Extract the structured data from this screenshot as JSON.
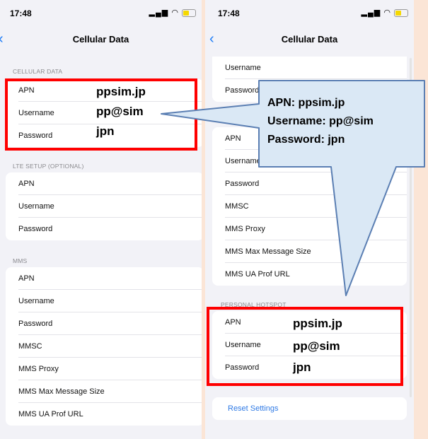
{
  "left": {
    "status": {
      "time": "17:48",
      "icons": "ᴵᴵᴵ ≋"
    },
    "nav": {
      "back": "‹",
      "title": "Cellular Data"
    },
    "sections": [
      {
        "header": "CELLULAR DATA",
        "rows": [
          "APN",
          "Username",
          "Password"
        ]
      },
      {
        "header": "LTE SETUP (OPTIONAL)",
        "rows": [
          "APN",
          "Username",
          "Password"
        ]
      },
      {
        "header": "MMS",
        "rows": [
          "APN",
          "Username",
          "Password",
          "MMSC",
          "MMS Proxy",
          "MMS Max Message Size",
          "MMS UA Prof URL"
        ]
      }
    ],
    "overlay": {
      "apn": "ppsim.jp",
      "username": "pp@sim",
      "password": "jpn"
    }
  },
  "right": {
    "status": {
      "time": "17:48",
      "icons": "ᴵᴵᴵ ≋"
    },
    "nav": {
      "back": "‹",
      "title": "Cellular Data"
    },
    "top_rows": [
      "Username",
      "Password"
    ],
    "lte_rows": [
      "APN",
      "Username",
      "Password",
      "MMSC",
      "MMS Proxy",
      "MMS Max Message Size",
      "MMS UA Prof URL"
    ],
    "hotspot": {
      "header": "PERSONAL HOTSPOT",
      "rows": [
        "APN",
        "Username",
        "Password"
      ]
    },
    "reset_label": "Reset Settings",
    "overlay": {
      "apn": "ppsim.jp",
      "username": "pp@sim",
      "password": "jpn"
    }
  },
  "callout": {
    "line1": "APN: ppsim.jp",
    "line2": "Username: pp@sim",
    "line3": "Password: jpn"
  },
  "colors": {
    "highlight": "#FF0000",
    "callout_fill": "#DAE8F5",
    "callout_border": "#5B7FB3",
    "link": "#2F7AE5",
    "page_bg": "#FBE5D6"
  }
}
